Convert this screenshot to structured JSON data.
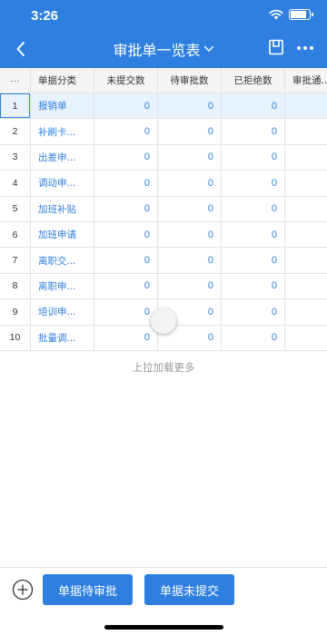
{
  "status": {
    "time": "3:26"
  },
  "nav": {
    "title": "审批单一览表"
  },
  "table": {
    "more_header": "···",
    "columns": [
      "单据分类",
      "未提交数",
      "待审批数",
      "已拒绝数",
      "审批通..."
    ],
    "rows": [
      {
        "index": "1",
        "category": "报销单",
        "unsubmitted": "0",
        "pending": "0",
        "rejected": "0"
      },
      {
        "index": "2",
        "category": "补刷卡...",
        "unsubmitted": "0",
        "pending": "0",
        "rejected": "0"
      },
      {
        "index": "3",
        "category": "出差申...",
        "unsubmitted": "0",
        "pending": "0",
        "rejected": "0"
      },
      {
        "index": "4",
        "category": "调动申...",
        "unsubmitted": "0",
        "pending": "0",
        "rejected": "0"
      },
      {
        "index": "5",
        "category": "加班补贴",
        "unsubmitted": "0",
        "pending": "0",
        "rejected": "0"
      },
      {
        "index": "6",
        "category": "加班申请",
        "unsubmitted": "0",
        "pending": "0",
        "rejected": "0"
      },
      {
        "index": "7",
        "category": "离职交...",
        "unsubmitted": "0",
        "pending": "0",
        "rejected": "0"
      },
      {
        "index": "8",
        "category": "离职申...",
        "unsubmitted": "0",
        "pending": "0",
        "rejected": "0"
      },
      {
        "index": "9",
        "category": "培训申...",
        "unsubmitted": "0",
        "pending": "0",
        "rejected": "0"
      },
      {
        "index": "10",
        "category": "批量调...",
        "unsubmitted": "0",
        "pending": "0",
        "rejected": "0"
      }
    ],
    "load_more": "上拉加载更多"
  },
  "bottom": {
    "pending_button": "单据待审批",
    "unsubmitted_button": "单据未提交"
  },
  "colors": {
    "primary": "#2e7fe0",
    "selected_row": "#e8f2fd"
  }
}
